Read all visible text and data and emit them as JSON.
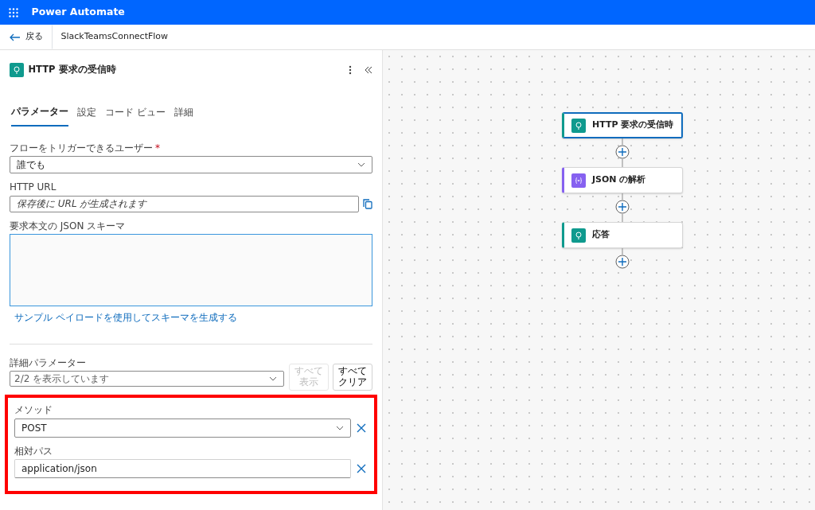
{
  "app_bar": {
    "title": "Power Automate"
  },
  "command_bar": {
    "back": "戻る",
    "flow_name": "SlackTeamsConnectFlow"
  },
  "panel": {
    "title": "HTTP 要求の受信時",
    "tabs": [
      {
        "label": "パラメーター",
        "selected": true
      },
      {
        "label": "設定",
        "selected": false
      },
      {
        "label": "コード ビュー",
        "selected": false
      },
      {
        "label": "詳細",
        "selected": false
      }
    ],
    "who_can_trigger": {
      "label": "フローをトリガーできるユーザー",
      "required_mark": "*",
      "value": "誰でも"
    },
    "http_url": {
      "label": "HTTP URL",
      "value": "保存後に URL が生成されます"
    },
    "schema": {
      "label": "要求本文の JSON スキーマ"
    },
    "generate_link": "サンプル ペイロードを使用してスキーマを生成する",
    "advanced": {
      "label": "詳細パラメーター",
      "value": "2/2 を表示しています",
      "buttons": [
        {
          "label": "すべて表示",
          "disabled": true
        },
        {
          "label": "すべてクリア",
          "disabled": false
        }
      ]
    },
    "params": [
      {
        "kind": "dropdown",
        "label": "メソッド",
        "value": "POST"
      },
      {
        "kind": "text",
        "label": "相対パス",
        "value": "application/json"
      }
    ]
  },
  "flow": {
    "nodes": [
      {
        "title": "HTTP 要求の受信時",
        "color": "#0f9a8e",
        "kind": "http",
        "selected": true
      },
      {
        "title": "JSON の解析",
        "color": "#8661f0",
        "kind": "json",
        "selected": false
      },
      {
        "title": "応答",
        "color": "#0f9a8e",
        "kind": "http",
        "selected": false
      }
    ]
  }
}
